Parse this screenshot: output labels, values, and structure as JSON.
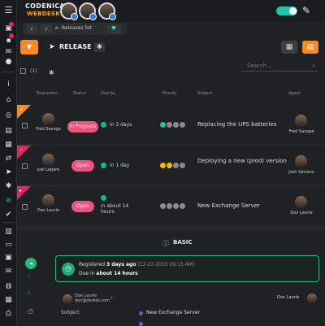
{
  "brand": {
    "name": "CODENICA",
    "product": "WEBDESK"
  },
  "breadcrumb": {
    "label": "Releases list"
  },
  "page": {
    "title": "RELEASE"
  },
  "search": {
    "placeholder": "Search..."
  },
  "list": {
    "selected_count": "(1)"
  },
  "columns": [
    "Requester",
    "Status",
    "Due by",
    "Priority",
    "Subject",
    "Agent"
  ],
  "rows": [
    {
      "flag_color": "#f58a26",
      "requester": "Fred Savage",
      "status": "In Progress",
      "status_bg": "#e8557f",
      "status_fg": "#ffd9e3",
      "due": "in 3 days",
      "priority": [
        "#23c48f",
        "#8a8c91",
        "#8a8c91",
        "#8a8c91"
      ],
      "subject": "Replacing the UPS batteries",
      "agent": "Fred Savage"
    },
    {
      "flag_color": "#e0245e",
      "requester": "Joel Legare",
      "status": "Open",
      "status_bg": "#e8557f",
      "status_fg": "#ffffff",
      "due": "in 1 day",
      "priority": [
        "#f5b800",
        "#f5b800",
        "#8a8c91",
        "#8a8c91"
      ],
      "subject": "Deploying a new (prod) version",
      "agent": "Josh Saviano"
    },
    {
      "flag_color": "#e0245e",
      "requester": "Don Laurie",
      "status": "Open",
      "status_bg": "#e8557f",
      "status_fg": "#ffffff",
      "due": "in about 14 hours",
      "priority": [
        "#8a8c91",
        "#8a8c91",
        "#8a8c91",
        "#8a8c91"
      ],
      "subject": "New Exchange Server",
      "agent": "Don Laurie"
    }
  ],
  "detail": {
    "section_title": "BASIC",
    "registered_prefix": "Registered",
    "registered_value": "3 days ago",
    "registered_date": "(12-22-2016 09:15 AM)",
    "due_prefix": "Due in",
    "due_value": "about 14 hours",
    "chat_name": "Don Laurie",
    "chat_email": "don@deskie.com",
    "chat_agent": "Don Laurie",
    "subject_label": "Subject",
    "subject_value": "New Exchange Server"
  },
  "colors": {
    "accent": "#f58a26",
    "success": "#23c4a4",
    "danger": "#e0245e"
  },
  "icons": [
    "hamburger-icon",
    "bell-icon",
    "mail-icon",
    "chat-icon",
    "info-icon",
    "rocket-icon",
    "gear-icon",
    "brush-icon",
    "clock-icon",
    "filter-icon"
  ]
}
